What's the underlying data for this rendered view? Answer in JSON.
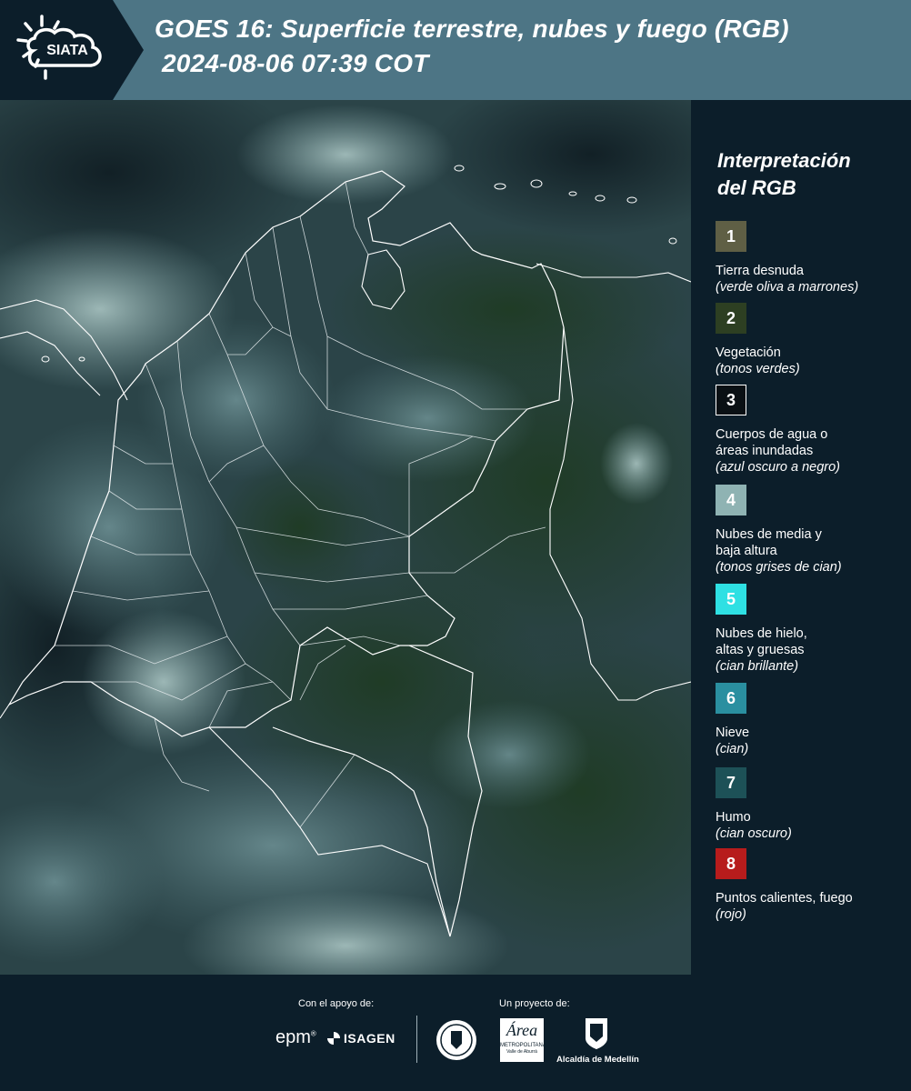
{
  "header": {
    "logo_text": "SIATA",
    "title_line1": "GOES 16: Superficie terrestre, nubes y fuego (RGB)",
    "title_line2": "2024-08-06 07:39 COT"
  },
  "legend": {
    "title_line1": "Interpretación",
    "title_line2": "del RGB",
    "items": [
      {
        "num": "1",
        "color": "#5f5f45",
        "label_lines": [
          "Tierra desnuda"
        ],
        "sub": "(verde oliva a marrones)"
      },
      {
        "num": "2",
        "color": "#2d3f22",
        "label_lines": [
          "Vegetación"
        ],
        "sub": "(tonos verdes)"
      },
      {
        "num": "3",
        "color": "#0a1014",
        "label_lines": [
          "Cuerpos de agua o",
          "áreas inundadas"
        ],
        "sub": "(azul oscuro a negro)"
      },
      {
        "num": "4",
        "color": "#8fb3b3",
        "label_lines": [
          "Nubes de media y",
          "baja altura"
        ],
        "sub": "(tonos grises de cian)"
      },
      {
        "num": "5",
        "color": "#2ee0e3",
        "label_lines": [
          "Nubes de hielo,",
          "altas y gruesas"
        ],
        "sub": "(cian brillante)"
      },
      {
        "num": "6",
        "color": "#2a8fa0",
        "label_lines": [
          "Nieve"
        ],
        "sub": "(cian)"
      },
      {
        "num": "7",
        "color": "#1d5157",
        "label_lines": [
          "Humo"
        ],
        "sub": "(cian oscuro)"
      },
      {
        "num": "8",
        "color": "#b71c1c",
        "label_lines": [
          "Puntos calientes, fuego"
        ],
        "sub": "(rojo)"
      }
    ]
  },
  "footer": {
    "support_label": "Con el apoyo de:",
    "project_label": "Un proyecto de:",
    "epm_text": "epm",
    "isagen_text": "ISAGEN",
    "metropolitana_text": "Área",
    "metropolitana_sub": "METROPOLITANA",
    "metropolitana_sub2": "Valle de Aburrá",
    "alcaldia_text": "Alcaldía de Medellín"
  }
}
